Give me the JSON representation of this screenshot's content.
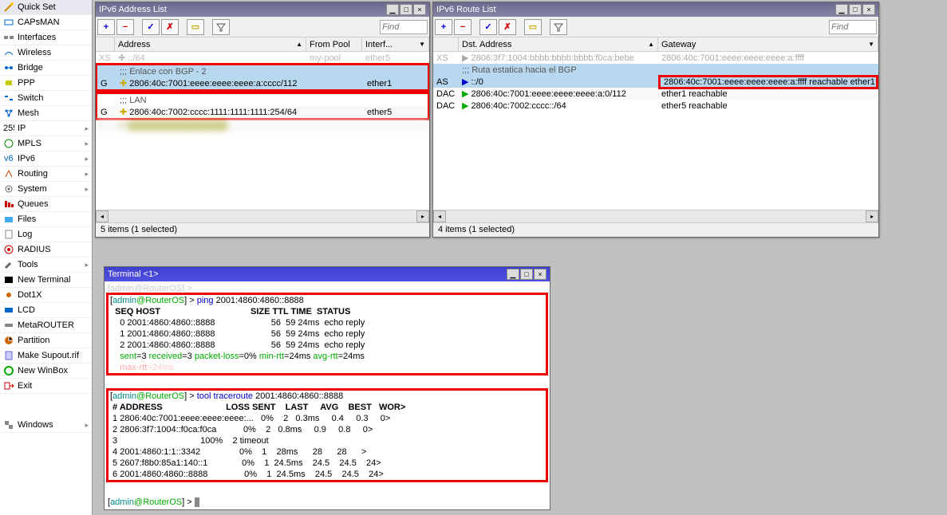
{
  "sidebar": {
    "items": [
      {
        "label": "Quick Set"
      },
      {
        "label": "CAPsMAN"
      },
      {
        "label": "Interfaces"
      },
      {
        "label": "Wireless"
      },
      {
        "label": "Bridge"
      },
      {
        "label": "PPP"
      },
      {
        "label": "Switch"
      },
      {
        "label": "Mesh"
      },
      {
        "label": "IP",
        "sub": true
      },
      {
        "label": "MPLS",
        "sub": true
      },
      {
        "label": "IPv6",
        "sub": true
      },
      {
        "label": "Routing",
        "sub": true
      },
      {
        "label": "System",
        "sub": true
      },
      {
        "label": "Queues"
      },
      {
        "label": "Files"
      },
      {
        "label": "Log"
      },
      {
        "label": "RADIUS"
      },
      {
        "label": "Tools",
        "sub": true
      },
      {
        "label": "New Terminal"
      },
      {
        "label": "Dot1X"
      },
      {
        "label": "LCD"
      },
      {
        "label": "MetaROUTER"
      },
      {
        "label": "Partition"
      },
      {
        "label": "Make Supout.rif"
      },
      {
        "label": "New WinBox"
      },
      {
        "label": "Exit"
      }
    ],
    "windows": "Windows"
  },
  "addrwin": {
    "title": "IPv6 Address List",
    "find": "Find",
    "cols": {
      "addr": "Address",
      "pool": "From Pool",
      "intf": "Interf..."
    },
    "comment_lan": ";;; LAN",
    "comment_bgp": ";;; Enlace con BGP - 2",
    "r0_flag": "XS",
    "r0_addr": "::/64",
    "r0_pool": "my-pool",
    "r0_intf": "ether5",
    "r1_flag": "G",
    "r1_addr": "2806:40c:7001:eeee:eeee:eeee:a:cccc/112",
    "r1_intf": "ether1",
    "r2_flag": "G",
    "r2_addr": "2806:40c:7002:cccc:1111:1111:1111:254/64",
    "r2_intf": "ether5",
    "status": "5 items (1 selected)"
  },
  "routewin": {
    "title": "IPv6 Route List",
    "find": "Find",
    "cols": {
      "dst": "Dst. Address",
      "gw": "Gateway"
    },
    "r0_flag": "XS",
    "r0_dst": "2806:3f7:1004:bbbb:bbbb:bbbb:f0ca:bebe",
    "r0_gw": "2806:40c:7001:eeee:eeee:eeee:a:ffff",
    "comment_bgp": ";;; Ruta estatica hacia el BGP",
    "r1_flag": "AS",
    "r1_dst": "::/0",
    "r1_gw": "2806:40c:7001:eeee:eeee:eeee:a:ffff reachable ether1",
    "r2_flag": "DAC",
    "r2_dst": "2806:40c:7001:eeee:eeee:eeee:a:0/112",
    "r2_gw": "ether1 reachable",
    "r3_flag": "DAC",
    "r3_dst": "2806:40c:7002:cccc::/64",
    "r3_gw": "ether5 reachable",
    "status": "4 items (1 selected)"
  },
  "term": {
    "title": "Terminal <1>",
    "l01": "[admin@RouterOS] > ",
    "l02a": "[",
    "l02b": "admin",
    "l02c": "@",
    "l02d": "RouterOS",
    "l02e": "] > ",
    "l02f": "ping ",
    "l02g": "2001:4860:4860::8888",
    "l03": "  SEQ HOST                                     SIZE TTL TIME  STATUS",
    "l04": "    0 2001:4860:4860::8888                       56  59 24ms  echo reply",
    "l05": "    1 2001:4860:4860::8888                       56  59 24ms  echo reply",
    "l06": "    2 2001:4860:4860::8888                       56  59 24ms  echo reply",
    "l07a": "    sent",
    "l07b": "=3 ",
    "l07c": "received",
    "l07d": "=3 ",
    "l07e": "packet-loss",
    "l07f": "=0% ",
    "l07g": "min-rtt",
    "l07h": "=24ms ",
    "l07i": "avg-rtt",
    "l07j": "=24ms",
    "l08a": "    max-rtt",
    "l08b": "=24ms",
    "l10a": "[",
    "l10b": "admin",
    "l10c": "@",
    "l10d": "RouterOS",
    "l10e": "] > ",
    "l10f": "tool traceroute ",
    "l10g": "2001:4860:4860::8888",
    "l11": " # ADDRESS                          LOSS SENT    LAST     AVG    BEST   WOR>",
    "l12": " 1 2806:40c:7001:eeee:eeee:eeee:...   0%    2   0.3ms     0.4     0.3     0>",
    "l13": " 2 2806:3f7:1004::f0ca:f0ca           0%    2   0.8ms     0.9     0.8     0>",
    "l14": " 3                                  100%    2 timeout",
    "l15": " 4 2001:4860:1:1::3342                0%    1    28ms      28      28      >",
    "l16": " 5 2607:f8b0:85a1:140::1              0%    1  24.5ms    24.5    24.5    24>",
    "l17": " 6 2001:4860:4860::8888               0%    1  24.5ms    24.5    24.5    24>",
    "l19a": "[",
    "l19b": "admin",
    "l19c": "@",
    "l19d": "RouterOS",
    "l19e": "] > "
  },
  "icons": {
    "plus": "+",
    "minus": "−",
    "check": "✓",
    "x": "✗",
    "note": "▭",
    "funnel": "▼"
  }
}
